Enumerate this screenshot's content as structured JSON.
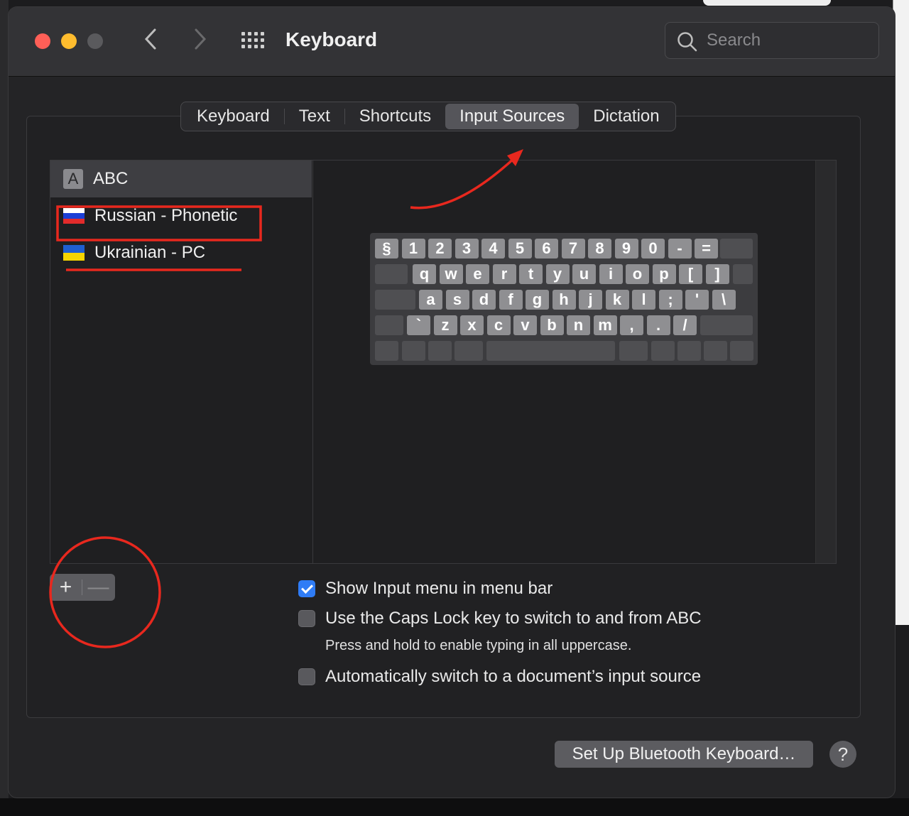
{
  "window": {
    "title": "Keyboard"
  },
  "search": {
    "placeholder": "Search"
  },
  "tabs": [
    {
      "label": "Keyboard"
    },
    {
      "label": "Text"
    },
    {
      "label": "Shortcuts"
    },
    {
      "label": "Input Sources",
      "active": true
    },
    {
      "label": "Dictation"
    }
  ],
  "sources": [
    {
      "label": "ABC",
      "icon": "letter-a-icon",
      "selected": true
    },
    {
      "label": "Russian - Phonetic",
      "icon": "russia-flag-icon"
    },
    {
      "label": "Ukrainian - PC",
      "icon": "ukraine-flag-icon"
    }
  ],
  "keyboard_preview": {
    "row1": [
      "§",
      "1",
      "2",
      "3",
      "4",
      "5",
      "6",
      "7",
      "8",
      "9",
      "0",
      "-",
      "="
    ],
    "row2": [
      "q",
      "w",
      "e",
      "r",
      "t",
      "y",
      "u",
      "i",
      "o",
      "p",
      "[",
      "]"
    ],
    "row3": [
      "a",
      "s",
      "d",
      "f",
      "g",
      "h",
      "j",
      "k",
      "l",
      ";",
      "'",
      "\\"
    ],
    "row4": [
      "`",
      "z",
      "x",
      "c",
      "v",
      "b",
      "n",
      "m",
      ",",
      ".",
      "/"
    ]
  },
  "list_controls": {
    "add": "+",
    "remove": "—"
  },
  "options": {
    "show_menu": {
      "label": "Show Input menu in menu bar",
      "checked": true
    },
    "caps_lock": {
      "label": "Use the Caps Lock key to switch to and from ABC",
      "checked": false,
      "hint": "Press and hold to enable typing in all uppercase."
    },
    "auto_switch": {
      "label": "Automatically switch to a document’s input source",
      "checked": false
    }
  },
  "footer": {
    "bluetooth_button": "Set Up Bluetooth Keyboard…",
    "help": "?"
  },
  "colors": {
    "accent": "#2f7cf6",
    "annotation": "#e8281e",
    "window_bg": "#242426"
  }
}
